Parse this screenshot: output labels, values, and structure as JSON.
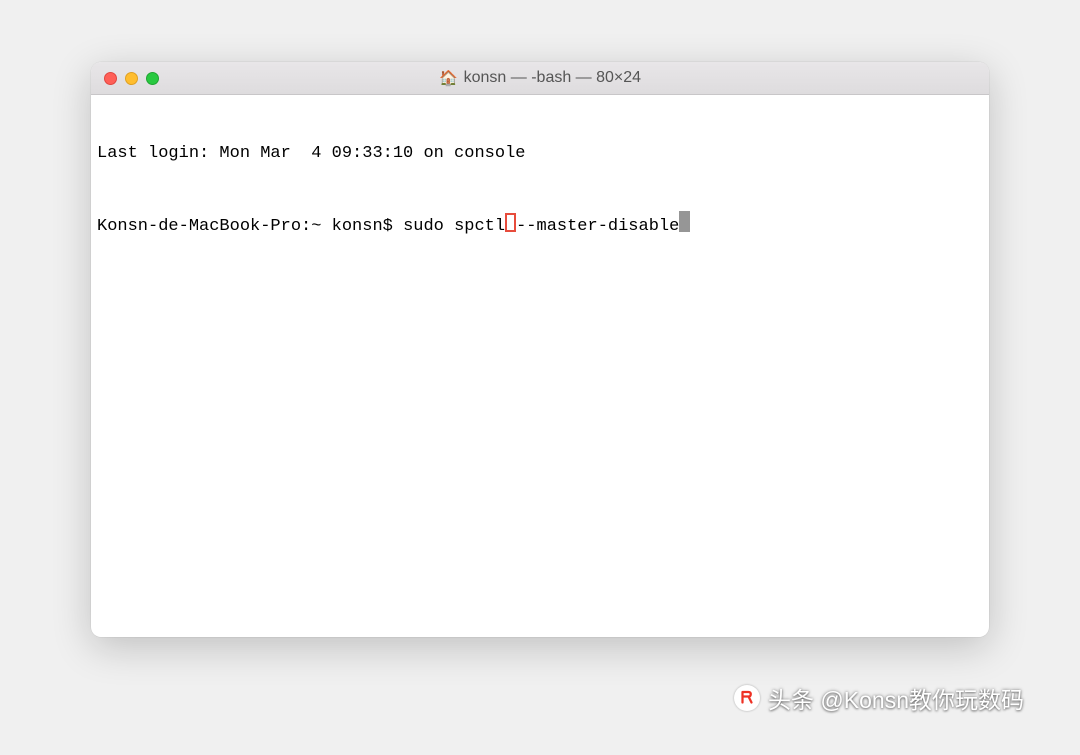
{
  "window": {
    "title": "konsn — -bash — 80×24"
  },
  "terminal": {
    "last_login": "Last login: Mon Mar  4 09:33:10 on console",
    "prompt": "Konsn-de-MacBook-Pro:~ konsn$ ",
    "command_part1": "sudo spctl",
    "command_part2": "--master-disable"
  },
  "watermark": {
    "text": "头条 @Konsn教你玩数码"
  }
}
